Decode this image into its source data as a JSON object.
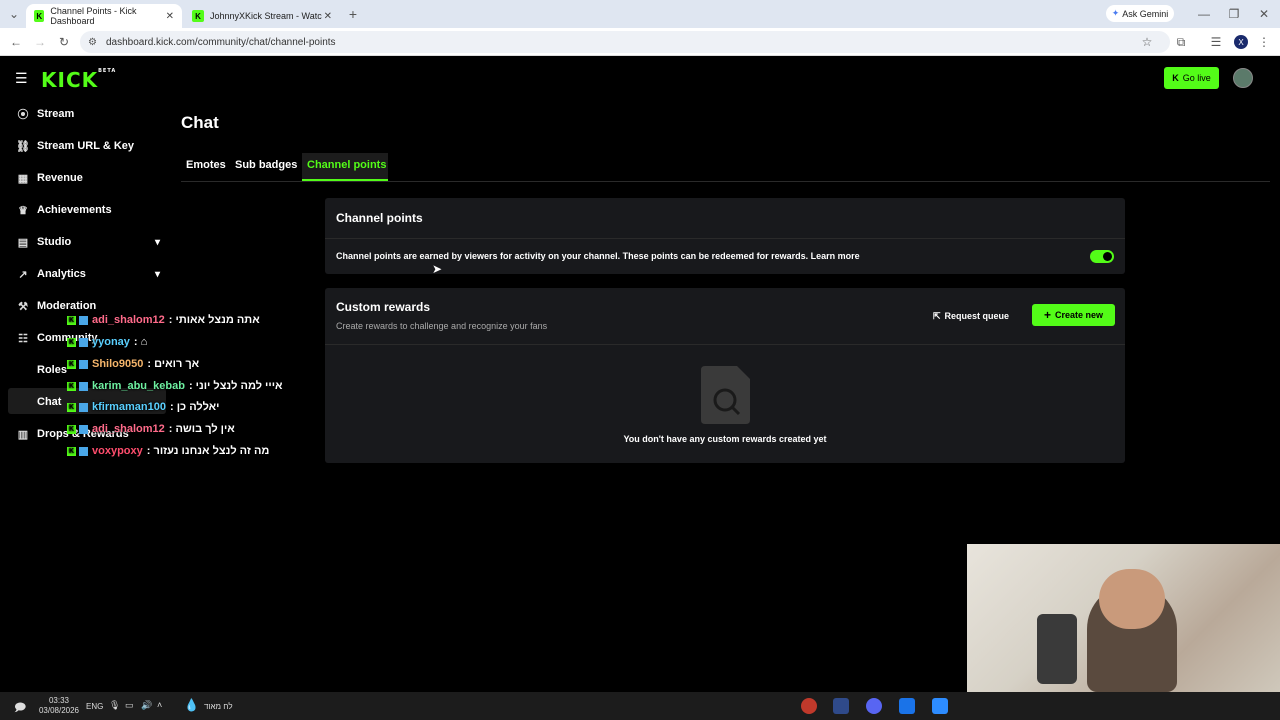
{
  "browser": {
    "tabs": [
      {
        "title": "Channel Points - Kick Dashboard",
        "active": true
      },
      {
        "title": "JohnnyXKick Stream - Watch Li...",
        "active": false
      }
    ],
    "new_tab": "+",
    "ask_gemini": "Ask Gemini",
    "url": "dashboard.kick.com/community/chat/channel-points"
  },
  "app": {
    "logo": "KICK",
    "logo_badge": "BETA",
    "go_live": "Go live",
    "sidebar": [
      {
        "label": "Stream",
        "icon": "((·))"
      },
      {
        "label": "Stream URL & Key",
        "icon": "⛓"
      },
      {
        "label": "Revenue",
        "icon": "▦"
      },
      {
        "label": "Achievements",
        "icon": "🏆"
      },
      {
        "label": "Studio",
        "icon": "▤",
        "chevron": "⌄"
      },
      {
        "label": "Analytics",
        "icon": "↗",
        "chevron": "⌄"
      },
      {
        "label": "Moderation",
        "icon": "🔨"
      },
      {
        "label": "Community",
        "icon": "👥"
      }
    ],
    "sidebar_sub": [
      "Roles",
      "Chat"
    ],
    "sidebar_last": {
      "label": "Drops & Rewards",
      "icon": "▥"
    },
    "page_title": "Chat",
    "tabs": [
      "Emotes",
      "Sub badges",
      "Channel points"
    ],
    "channel_points": {
      "title": "Channel points",
      "description": "Channel points are earned by viewers for activity on your channel. These points can be redeemed for rewards.",
      "learn_more": "Learn more",
      "enabled": true
    },
    "custom_rewards": {
      "title": "Custom rewards",
      "subtitle": "Create rewards to challenge and recognize your fans",
      "request_queue": "Request queue",
      "create_new": "Create new",
      "empty_text": "You don't have any custom rewards created yet"
    }
  },
  "chat_overlay": [
    {
      "user": "adi_shalom12",
      "color": "#ff6b8a",
      "msg": ": אתה מנצל אאותי"
    },
    {
      "user": "yyonay",
      "color": "#5ad0ff",
      "msg": ": ⌂"
    },
    {
      "user": "Shilo9050",
      "color": "#f5b56b",
      "msg": ": אך רואים"
    },
    {
      "user": "karim_abu_kebab",
      "color": "#6df0a0",
      "msg": ": אייי למה לנצל יוני"
    },
    {
      "user": "kfirmaman100",
      "color": "#5ad0ff",
      "msg": ": יאללה כן"
    },
    {
      "user": "adi_shalom12",
      "color": "#ff6b8a",
      "msg": ": אין לך בושה"
    },
    {
      "user": "voxypoxy",
      "color": "#ff4d6d",
      "msg": ": מה זה לנצל אנחנו נעזור"
    }
  ],
  "taskbar": {
    "time": "03:33",
    "date": "03/08/2026",
    "lang": "ENG",
    "weather": "לח מאוד"
  }
}
